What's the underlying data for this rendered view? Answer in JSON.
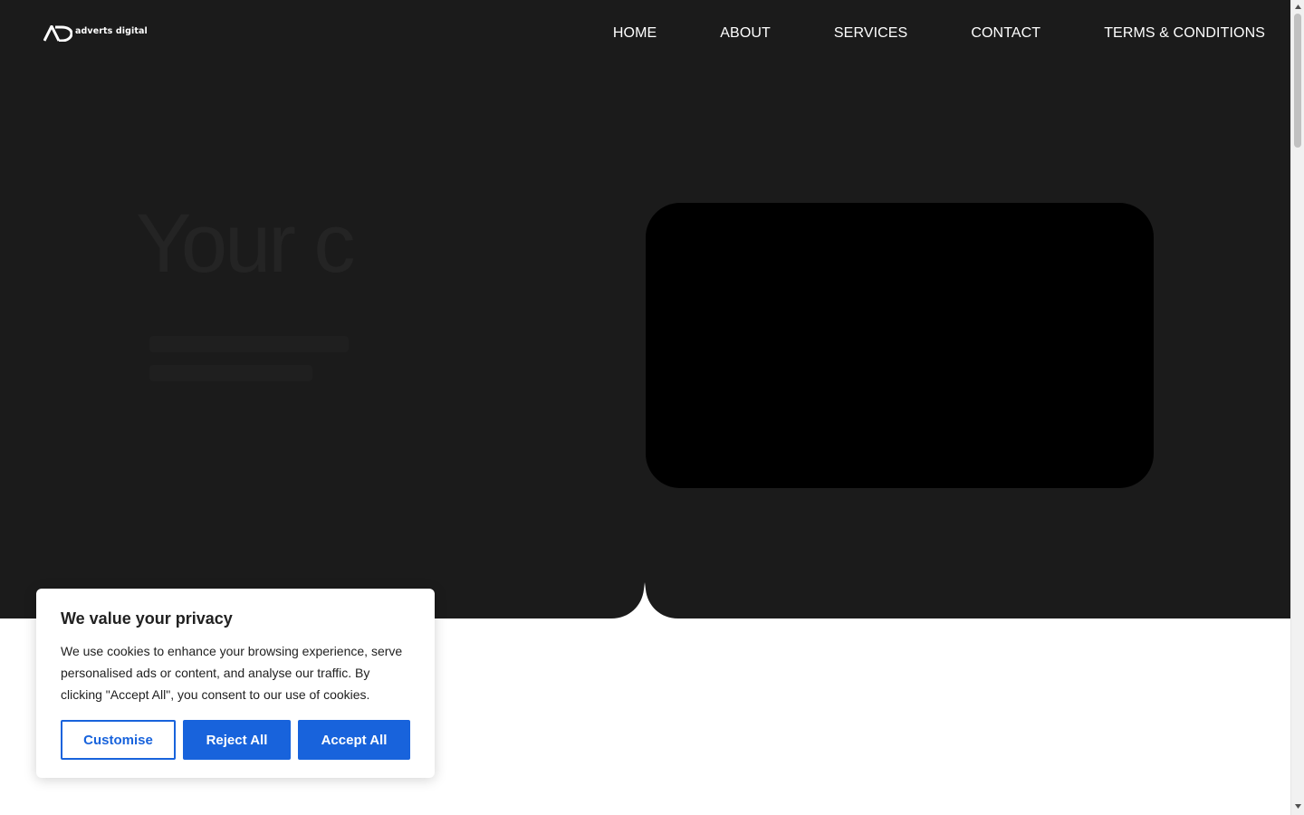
{
  "header": {
    "logo_text": "adverts digital",
    "logo_icon": "ad-monogram-logo",
    "nav": [
      {
        "label": "HOME"
      },
      {
        "label": "ABOUT"
      },
      {
        "label": "SERVICES"
      },
      {
        "label": "CONTACT"
      },
      {
        "label": "TERMS & CONDITIONS"
      }
    ]
  },
  "hero": {
    "heading": "Your c"
  },
  "cookie_banner": {
    "title": "We value your privacy",
    "message": "We use cookies to enhance your browsing experience, serve personalised ads or content, and analyse our traffic. By clicking \"Accept All\", you consent to our use of cookies.",
    "customise_label": "Customise",
    "reject_label": "Reject All",
    "accept_label": "Accept All"
  },
  "colors": {
    "header_bg": "#1b1b1b",
    "hero_bg": "#1b1b1b",
    "media_bg": "#000000",
    "accent": "#1863dc",
    "text_dark": "#212121",
    "page_bg": "#ffffff"
  },
  "scrollbar": {
    "icons": [
      "scroll-up-arrow-icon",
      "scroll-down-arrow-icon"
    ]
  }
}
